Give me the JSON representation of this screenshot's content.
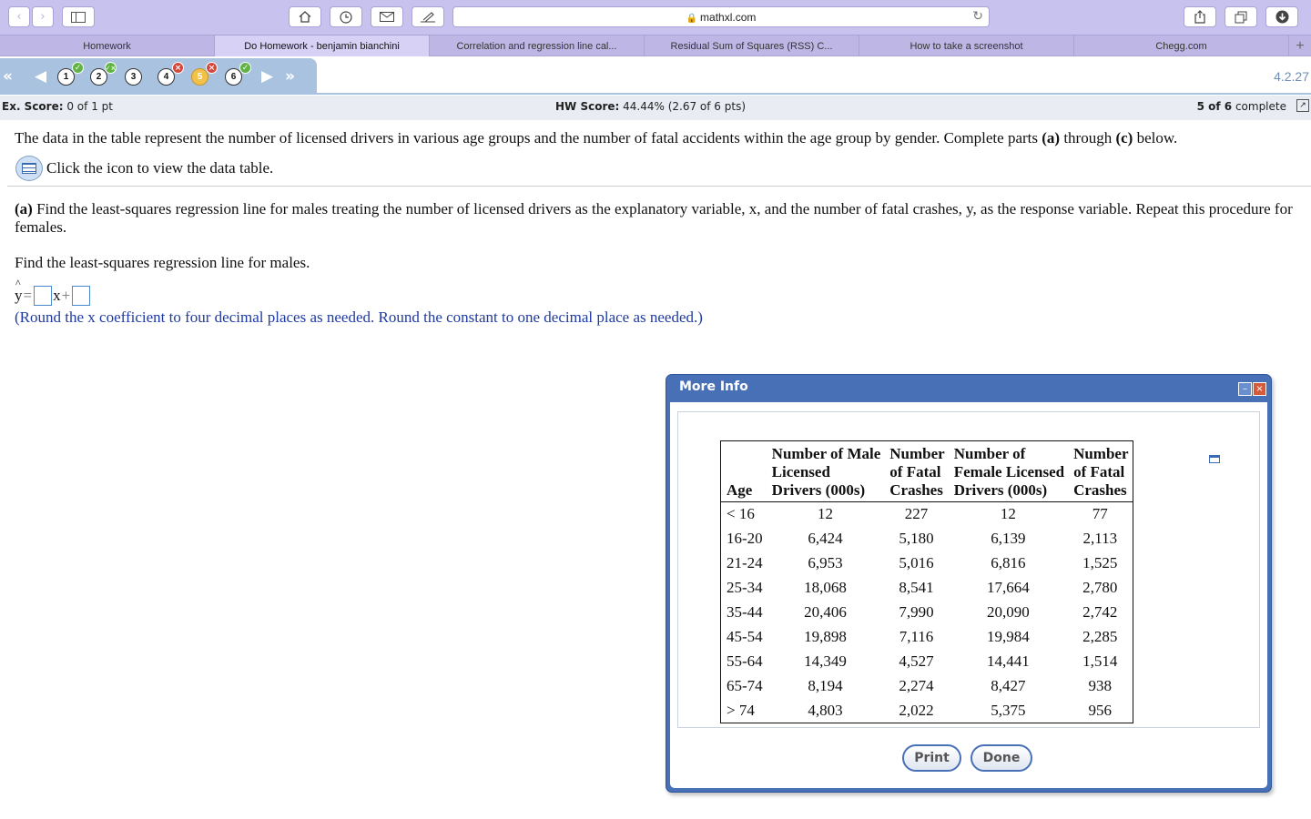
{
  "browser": {
    "url": "mathxl.com",
    "tabs": [
      {
        "label": "Homework",
        "active": false
      },
      {
        "label": "Do Homework - benjamin bianchini",
        "active": true
      },
      {
        "label": "Correlation and regression line cal...",
        "active": false
      },
      {
        "label": "Residual Sum of Squares (RSS) C...",
        "active": false
      },
      {
        "label": "How to take a screenshot",
        "active": false
      },
      {
        "label": "Chegg.com",
        "active": false
      }
    ],
    "icons": [
      "back-icon",
      "forward-icon",
      "sidebar-icon",
      "home-icon",
      "history-icon",
      "mail-icon",
      "edit-icon",
      "reload-icon",
      "share-icon",
      "tabs-icon",
      "download-icon"
    ]
  },
  "qnav": {
    "questions": [
      {
        "num": "1",
        "status": "correct"
      },
      {
        "num": "2",
        "status": "partial"
      },
      {
        "num": "3",
        "status": "none"
      },
      {
        "num": "4",
        "status": "incorrect"
      },
      {
        "num": "5",
        "status": "incorrect",
        "current": true
      },
      {
        "num": "6",
        "status": "correct"
      }
    ],
    "version": "4.2.27"
  },
  "score": {
    "ex_label": "Ex. Score:",
    "ex_value": "0 of 1 pt",
    "hw_label": "HW Score:",
    "hw_value": "44.44% (2.67 of 6 pts)",
    "progress_bold": "5 of 6",
    "progress_rest": "complete"
  },
  "question": {
    "intro_1": "The data in the table represent the number of licensed drivers in various age groups and the number of fatal accidents within the age group by gender. Complete parts ",
    "intro_a": "(a)",
    "intro_2": " through ",
    "intro_c": "(c)",
    "intro_3": " below.",
    "icon_text": "Click the icon to view the data table.",
    "part_a_label": "(a)",
    "part_a_text": " Find the least-squares regression line for males treating the number of licensed drivers as the explanatory variable, x, and the number of fatal crashes, y, as the response variable. Repeat this procedure for females.",
    "find_males": "Find the least-squares regression line for males.",
    "eq_y": "y",
    "eq_eq": "=",
    "eq_x": "x",
    "eq_plus": "+",
    "rounding": "(Round the x coefficient to four decimal places as needed. Round the constant to one decimal place as needed.)"
  },
  "modal": {
    "title": "More Info",
    "headers": [
      [
        "Age"
      ],
      [
        "Number of Male",
        "Licensed",
        "Drivers (000s)"
      ],
      [
        "Number",
        "of Fatal",
        "Crashes"
      ],
      [
        "Number of",
        "Female Licensed",
        "Drivers (000s)"
      ],
      [
        "Number",
        "of Fatal",
        "Crashes"
      ]
    ],
    "rows": [
      [
        "< 16",
        "12",
        "227",
        "12",
        "77"
      ],
      [
        "16-20",
        "6,424",
        "5,180",
        "6,139",
        "2,113"
      ],
      [
        "21-24",
        "6,953",
        "5,016",
        "6,816",
        "1,525"
      ],
      [
        "25-34",
        "18,068",
        "8,541",
        "17,664",
        "2,780"
      ],
      [
        "35-44",
        "20,406",
        "7,990",
        "20,090",
        "2,742"
      ],
      [
        "45-54",
        "19,898",
        "7,116",
        "19,984",
        "2,285"
      ],
      [
        "55-64",
        "14,349",
        "4,527",
        "14,441",
        "1,514"
      ],
      [
        "65-74",
        "8,194",
        "2,274",
        "8,427",
        "938"
      ],
      [
        "> 74",
        "4,803",
        "2,022",
        "5,375",
        "956"
      ]
    ],
    "print_label": "Print",
    "done_label": "Done"
  }
}
